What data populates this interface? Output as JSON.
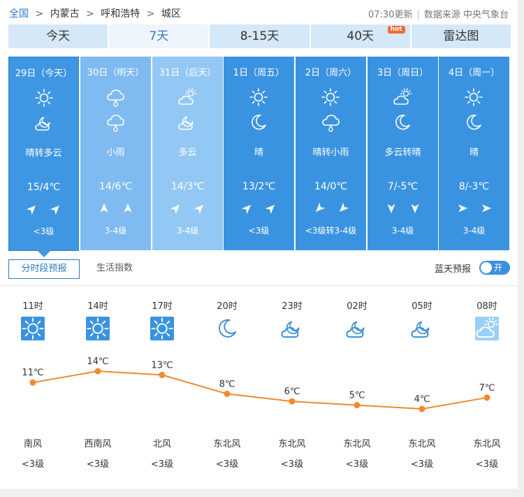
{
  "breadcrumb": {
    "items": [
      "全国",
      "内蒙古",
      "呼和浩特",
      "城区"
    ],
    "separator": ">"
  },
  "meta": {
    "updated": "07:30更新",
    "source": "数据来源 中央气象台"
  },
  "tabs": [
    {
      "label": "今天",
      "active": false
    },
    {
      "label": "7天",
      "active": true
    },
    {
      "label": "8-15天",
      "active": false
    },
    {
      "label": "40天",
      "active": false,
      "badge": "hot"
    },
    {
      "label": "雷达图",
      "active": false
    }
  ],
  "days": [
    {
      "date": "29日（今天）",
      "icons": [
        "sun-icon",
        "partly-cloudy-night-icon"
      ],
      "weather": "晴转多云",
      "temp": "15/4℃",
      "winds": [
        "northeast-wind-arrow-icon",
        "northeast-wind-arrow-icon"
      ],
      "level": "<3级"
    },
    {
      "date": "30日（明天）",
      "icons": [
        "rain-icon",
        "rain-icon"
      ],
      "weather": "小雨",
      "temp": "14/6℃",
      "winds": [
        "north-wind-arrow-icon",
        "north-wind-arrow-icon"
      ],
      "level": "3-4级"
    },
    {
      "date": "31日（后天）",
      "icons": [
        "partly-cloudy-icon",
        "partly-cloudy-night-icon"
      ],
      "weather": "多云",
      "temp": "14/3℃",
      "winds": [
        "northeast-wind-arrow-icon",
        "northeast-wind-arrow-icon"
      ],
      "level": "3-4级"
    },
    {
      "date": "1日（周五）",
      "icons": [
        "sun-icon",
        "moon-icon"
      ],
      "weather": "晴",
      "temp": "13/2℃",
      "winds": [
        "northeast-wind-arrow-icon",
        "northeast-wind-arrow-icon"
      ],
      "level": "<3级"
    },
    {
      "date": "2日（周六）",
      "icons": [
        "sun-icon",
        "rain-icon"
      ],
      "weather": "晴转小雨",
      "temp": "14/0℃",
      "winds": [
        "southwest-wind-arrow-icon",
        "southwest-wind-arrow-icon"
      ],
      "level": "<3级转3-4级"
    },
    {
      "date": "3日（周日）",
      "icons": [
        "partly-cloudy-icon",
        "moon-icon"
      ],
      "weather": "多云转晴",
      "temp": "7/-5℃",
      "winds": [
        "south-wind-arrow-icon",
        "south-wind-arrow-icon"
      ],
      "level": "3-4级"
    },
    {
      "date": "4日（周一）",
      "icons": [
        "sun-icon",
        "moon-icon"
      ],
      "weather": "晴",
      "temp": "8/-3℃",
      "winds": [
        "east-wind-arrow-icon",
        "east-wind-arrow-icon"
      ],
      "level": "3-4级"
    }
  ],
  "subtabs": {
    "active": "分时段预报",
    "other": "生活指数"
  },
  "bluesky": {
    "label": "蓝天预报",
    "toggle": "开"
  },
  "hourly": [
    {
      "time": "11时",
      "icon": "sun-icon",
      "temp_label": "11℃",
      "wind_dir": "南风",
      "wind_level": "<3级"
    },
    {
      "time": "14时",
      "icon": "sun-icon",
      "temp_label": "14℃",
      "wind_dir": "西南风",
      "wind_level": "<3级"
    },
    {
      "time": "17时",
      "icon": "sun-icon",
      "temp_label": "13℃",
      "wind_dir": "北风",
      "wind_level": "<3级"
    },
    {
      "time": "20时",
      "icon": "moon-icon",
      "temp_label": "8℃",
      "wind_dir": "东北风",
      "wind_level": "<3级"
    },
    {
      "time": "23时",
      "icon": "partly-cloudy-night-icon",
      "temp_label": "6℃",
      "wind_dir": "东北风",
      "wind_level": "<3级"
    },
    {
      "time": "02时",
      "icon": "partly-cloudy-night-icon",
      "temp_label": "5℃",
      "wind_dir": "东北风",
      "wind_level": "<3级"
    },
    {
      "time": "05时",
      "icon": "partly-cloudy-night-icon",
      "temp_label": "4℃",
      "wind_dir": "东北风",
      "wind_level": "<3级"
    },
    {
      "time": "08时",
      "icon": "partly-cloudy-icon",
      "temp_label": "7℃",
      "wind_dir": "东北风",
      "wind_level": "<3级"
    }
  ],
  "chart_data": {
    "type": "line",
    "categories": [
      "11时",
      "14时",
      "17时",
      "20时",
      "23时",
      "02时",
      "05时",
      "08时"
    ],
    "series": [
      {
        "values": [
          11,
          14,
          13,
          8,
          6,
          5,
          4,
          7
        ]
      }
    ],
    "unit": "℃",
    "color": "#f08a2e"
  },
  "colors": {
    "accent": "#2a7ac7",
    "day_bg": "#3a93e0",
    "past_day_bg": "#8fc3f2",
    "tab_bg": "#d5e8f8",
    "line": "#f08a2e",
    "hot": "#f46a2d"
  }
}
